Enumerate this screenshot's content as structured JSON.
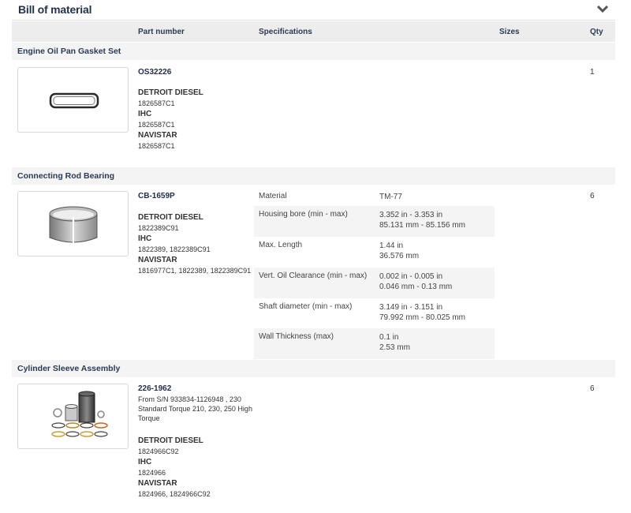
{
  "header": {
    "title": "Bill of material",
    "collapse_icon": "chevron-down-icon"
  },
  "columns": {
    "part_number": "Part number",
    "specifications": "Specifications",
    "sizes": "Sizes",
    "qty": "Qty"
  },
  "sections": [
    {
      "name": "Engine Oil Pan Gasket Set",
      "part_number": "OS32226",
      "qty": "1",
      "image": "gasket-image",
      "brands": [
        {
          "name": "DETROIT DIESEL",
          "numbers": "1826587C1"
        },
        {
          "name": "IHC",
          "numbers": "1826587C1"
        },
        {
          "name": "NAVISTAR",
          "numbers": "1826587C1"
        }
      ]
    },
    {
      "name": "Connecting Rod Bearing",
      "part_number": "CB-1659P",
      "qty": "6",
      "image": "bearing-image",
      "brands": [
        {
          "name": "DETROIT DIESEL",
          "numbers": "1822389C91"
        },
        {
          "name": "IHC",
          "numbers": "1822389, 1822389C91"
        },
        {
          "name": "NAVISTAR",
          "numbers": "1816977C1, 1822389, 1822389C91"
        }
      ],
      "specs": [
        {
          "label": "Material",
          "value1": "TM-77",
          "value2": ""
        },
        {
          "label": "Housing bore (min - max)",
          "value1": "3.352 in - 3.353 in",
          "value2": "85.131 mm - 85.156 mm"
        },
        {
          "label": "Max. Length",
          "value1": "1.44 in",
          "value2": "36.576 mm"
        },
        {
          "label": "Vert. Oil Clearance (min - max)",
          "value1": "0.002 in - 0.005 in",
          "value2": "0.046 mm - 0.13 mm"
        },
        {
          "label": "Shaft diameter (min - max)",
          "value1": "3.149 in - 3.151 in",
          "value2": "79.992 mm - 80.025 mm"
        },
        {
          "label": "Wall Thickness (max)",
          "value1": "0.1 in",
          "value2": "2.53 mm"
        }
      ]
    },
    {
      "name": "Cylinder Sleeve Assembly",
      "part_number": "226-1962",
      "note": "From S/N 933834-1126948 , 230 Standard Torque 210, 230, 250 High Torque",
      "qty": "6",
      "image": "cylinder-sleeve-kit-image",
      "brands": [
        {
          "name": "DETROIT DIESEL",
          "numbers": "1824966C92"
        },
        {
          "name": "IHC",
          "numbers": "1824966"
        },
        {
          "name": "NAVISTAR",
          "numbers": "1824966, 1824966C92"
        }
      ]
    }
  ]
}
